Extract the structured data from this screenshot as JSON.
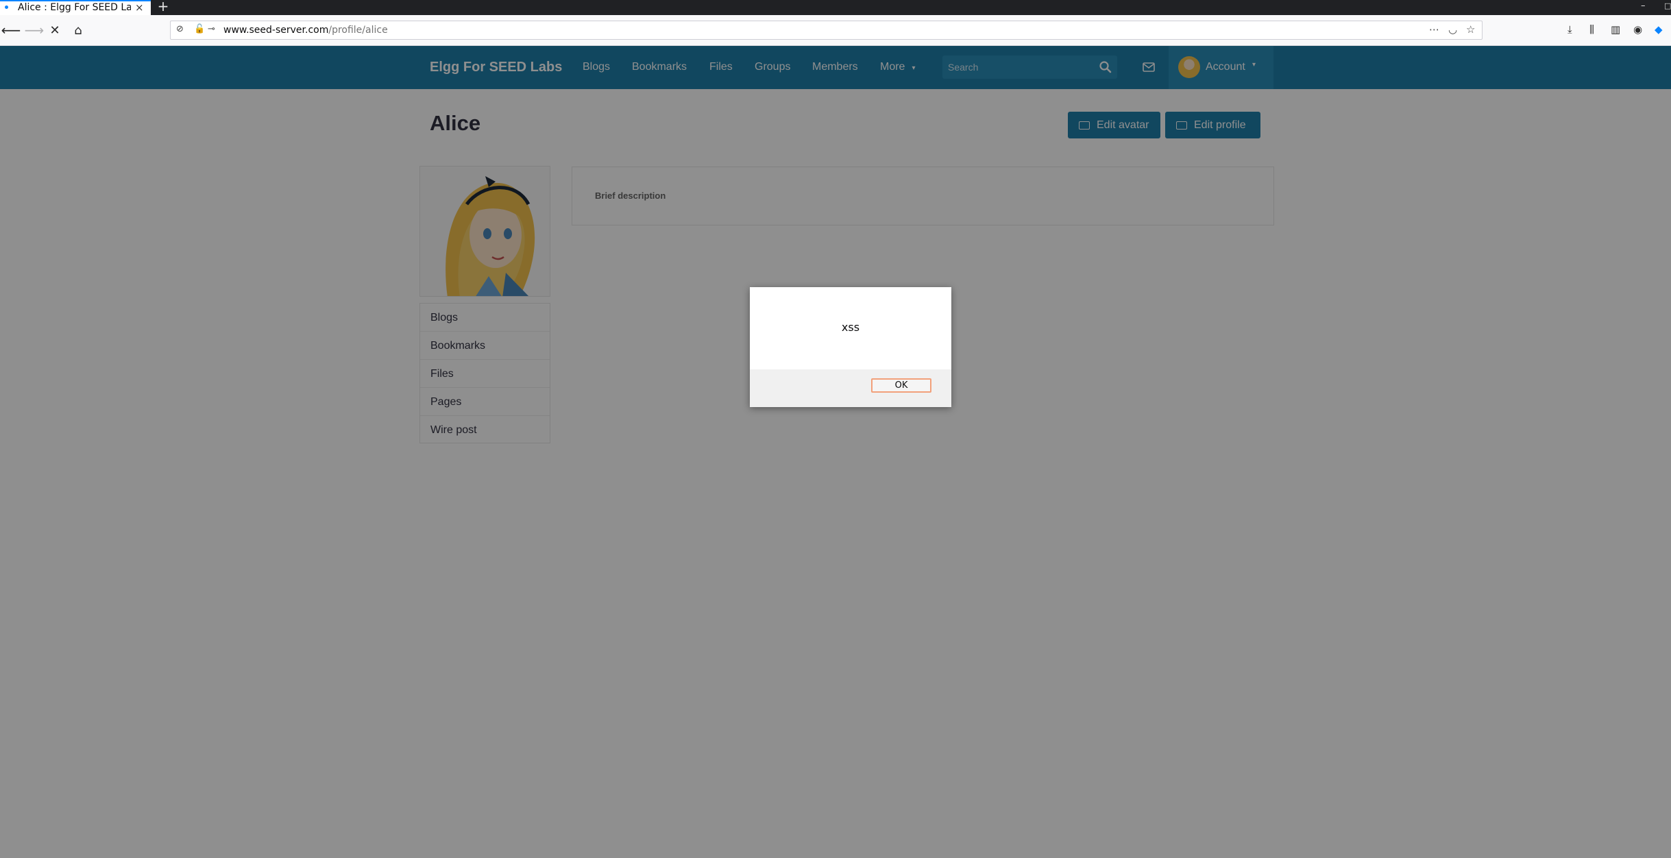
{
  "browser": {
    "tab_title": "Alice : Elgg For SEED Labs",
    "new_tab": "+",
    "url_host": "www.seed-server.com",
    "url_path": "/profile/alice"
  },
  "site": {
    "brand": "Elgg For SEED Labs",
    "menu": [
      "Blogs",
      "Bookmarks",
      "Files",
      "Groups",
      "Members",
      "More"
    ],
    "search_placeholder": "Search",
    "account_label": "Account"
  },
  "profile": {
    "name": "Alice",
    "edit_avatar": "Edit avatar",
    "edit_profile": "Edit profile",
    "owner_links": [
      "Blogs",
      "Bookmarks",
      "Files",
      "Pages",
      "Wire post"
    ],
    "brief_description_label": "Brief description"
  },
  "dialog": {
    "message": "xss",
    "ok_label": "OK"
  },
  "colors": {
    "brand_blue": "#1f7fa9",
    "overlay": "rgba(0,0,0,0.44)"
  }
}
